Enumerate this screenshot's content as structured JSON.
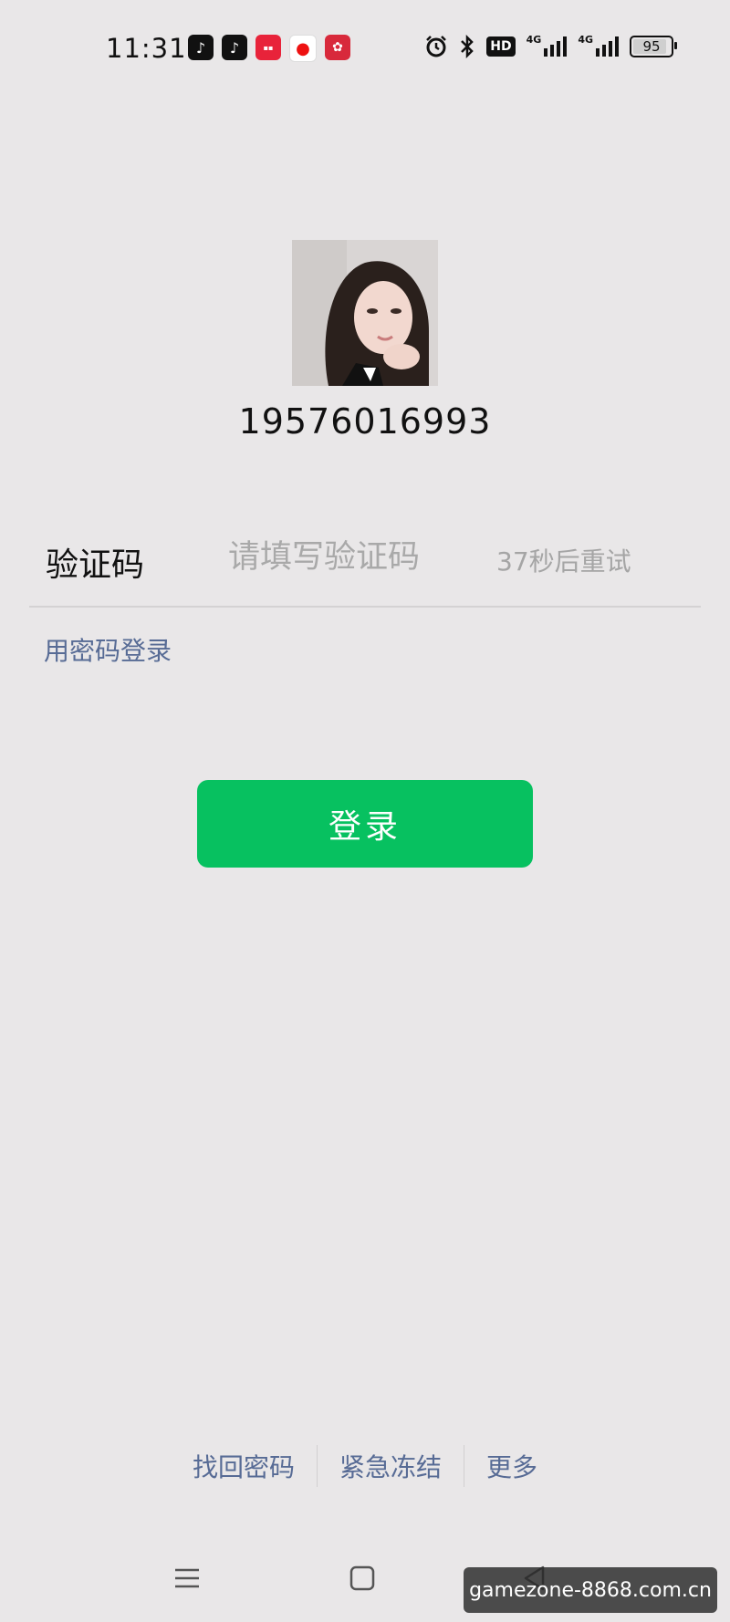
{
  "status_bar": {
    "time": "11:31",
    "app_icons": [
      "douyin-icon",
      "douyin-lite-icon",
      "xiaohongshu-icon",
      "toutiao-icon",
      "pinduoduo-icon"
    ],
    "hd_label": "HD",
    "network_1": "4G",
    "network_2": "4G",
    "battery_level": "95"
  },
  "account": {
    "phone_number": "19576016993"
  },
  "verification": {
    "label": "验证码",
    "placeholder": "请填写验证码",
    "retry_text": "37秒后重试"
  },
  "password_login_link": "用密码登录",
  "login_button": "登录",
  "bottom_links": {
    "find_password": "找回密码",
    "emergency_freeze": "紧急冻结",
    "more": "更多"
  },
  "watermark": "gamezone-8868.com.cn",
  "colors": {
    "background": "#e9e7e8",
    "primary_green": "#07c160",
    "link_blue": "#576b95",
    "placeholder_gray": "#a9a9a9"
  }
}
